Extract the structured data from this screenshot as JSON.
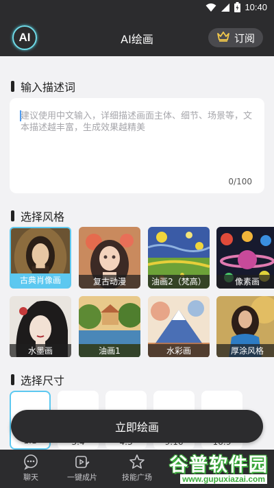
{
  "status_bar": {
    "time": "10:40"
  },
  "header": {
    "logo_text": "AI",
    "title": "AI绘画",
    "subscribe_label": "订阅"
  },
  "description": {
    "section_title": "输入描述词",
    "placeholder": "建议使用中文输入，详细描述画面主体、细节、场景等，文本描述越丰富，生成效果越精美",
    "counter": "0/100"
  },
  "styles": {
    "section_title": "选择风格",
    "selected_index": 0,
    "items": [
      {
        "label": "古典肖像画",
        "thumb": "classic-portrait"
      },
      {
        "label": "复古动漫",
        "thumb": "retro-anime"
      },
      {
        "label": "油画2（梵高）",
        "thumb": "van-gogh"
      },
      {
        "label": "像素画",
        "thumb": "pixel-art"
      },
      {
        "label": "水墨画",
        "thumb": "ink-painting"
      },
      {
        "label": "油画1",
        "thumb": "oil-painting"
      },
      {
        "label": "水彩画",
        "thumb": "watercolor"
      },
      {
        "label": "厚涂风格",
        "thumb": "impasto"
      }
    ]
  },
  "sizes": {
    "section_title": "选择尺寸",
    "items": [
      {
        "label": "1:1"
      },
      {
        "label": "3:4"
      },
      {
        "label": "4:3"
      },
      {
        "label": "9:16"
      },
      {
        "label": "16:9"
      }
    ]
  },
  "draw_button": "立即绘画",
  "tabs": [
    {
      "label": "聊天",
      "icon": "chat-icon"
    },
    {
      "label": "一键成片",
      "icon": "video-edit-icon"
    },
    {
      "label": "技能广场",
      "icon": "star-icon"
    }
  ],
  "watermark": {
    "text": "谷普软件园",
    "url": "www.gupuxiazai.com"
  },
  "colors": {
    "dark": "#2c2c2e",
    "accent": "#5cc8f0",
    "background": "#f2f2f4"
  }
}
